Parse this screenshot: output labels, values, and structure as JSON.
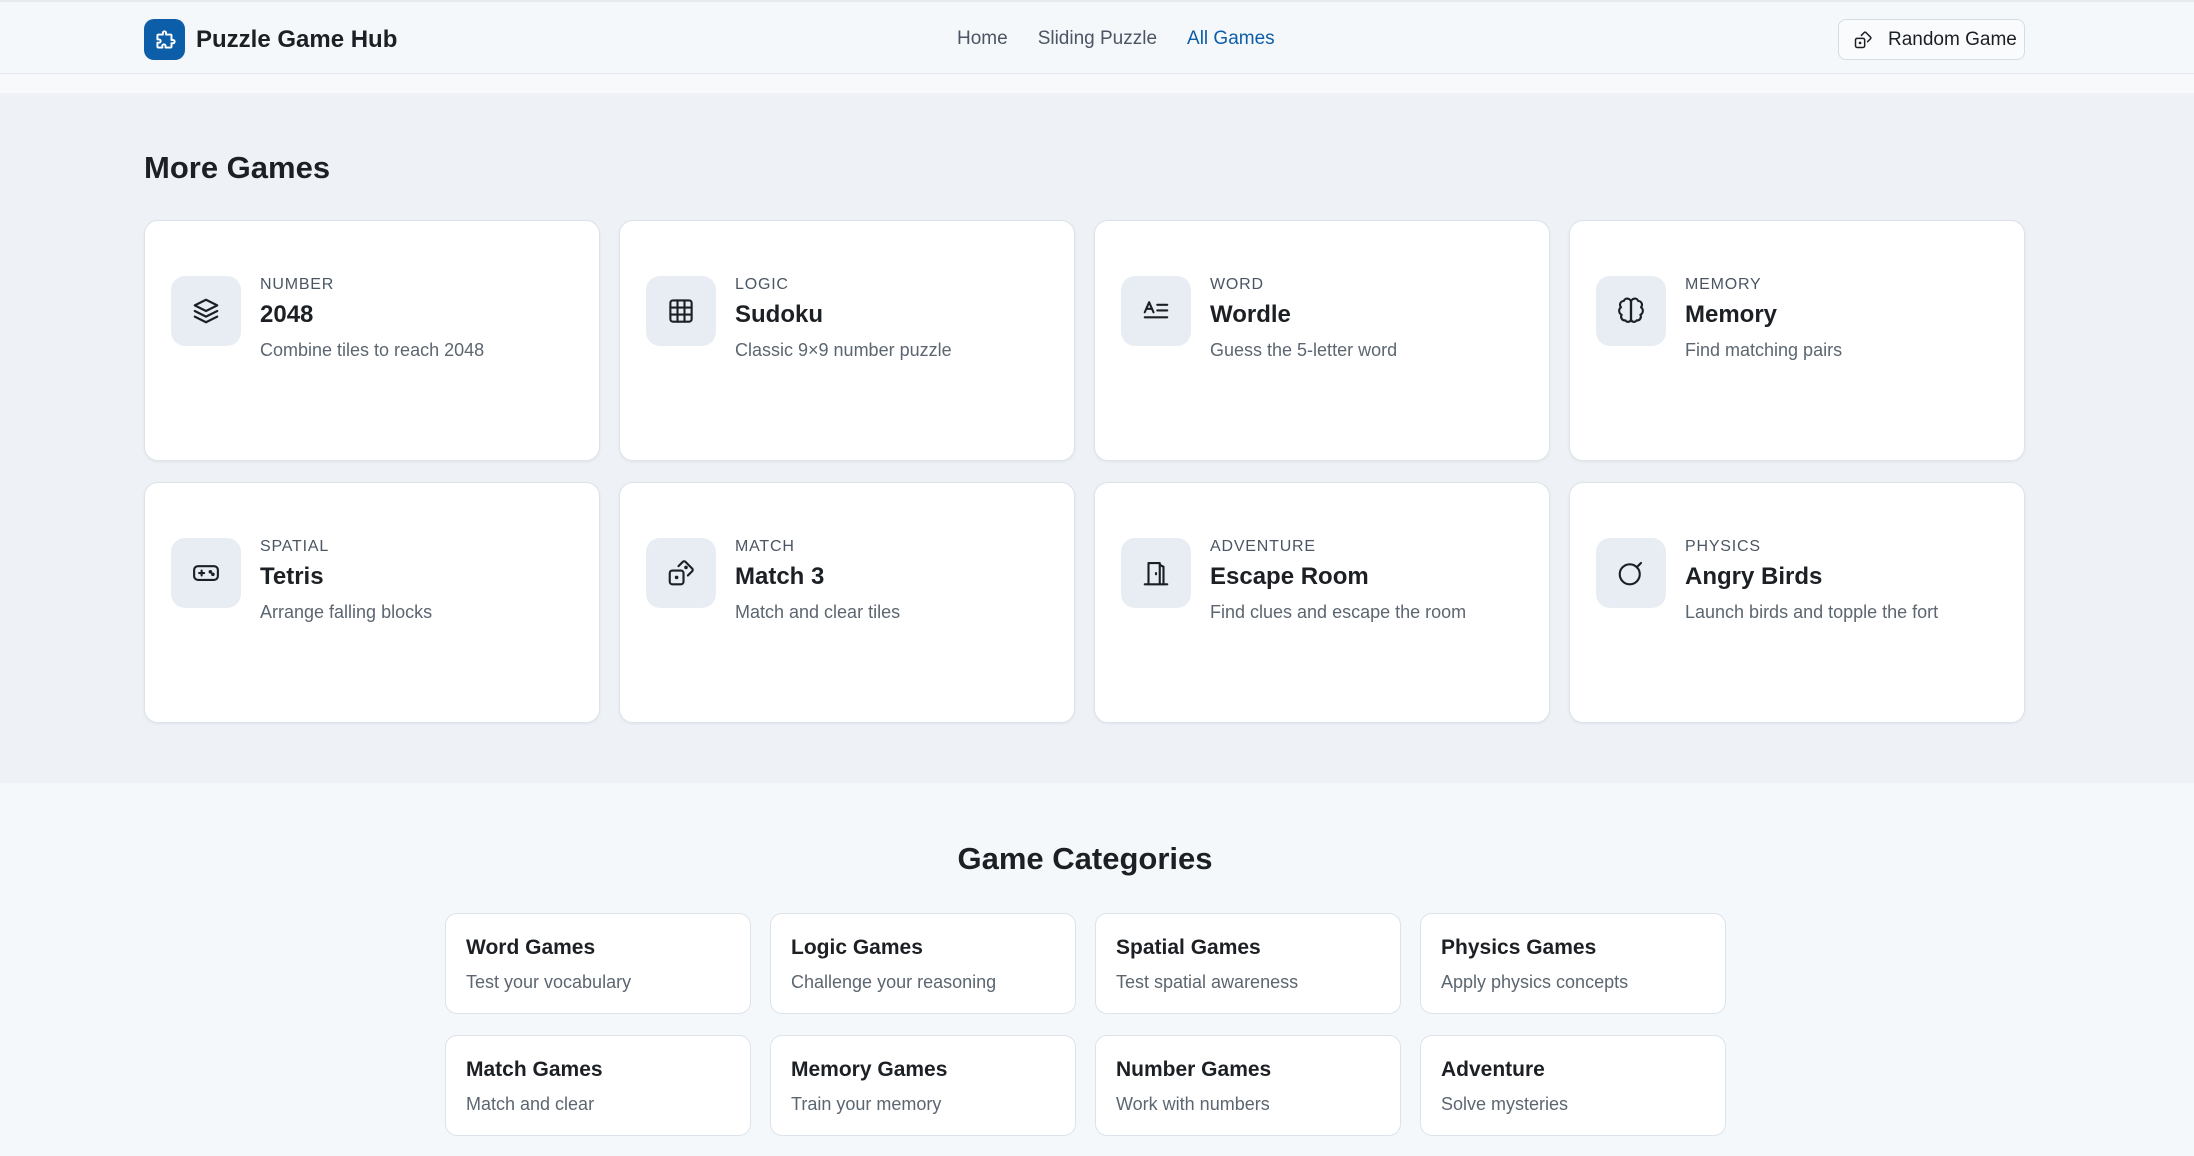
{
  "header": {
    "brand": "Puzzle Game Hub",
    "nav": [
      {
        "label": "Home",
        "active": false
      },
      {
        "label": "Sliding Puzzle",
        "active": false
      },
      {
        "label": "All Games",
        "active": true
      }
    ],
    "random_button": "Random Game",
    "accent_color": "#0d5ea8"
  },
  "games_section": {
    "title": "More Games",
    "games": [
      {
        "category": "NUMBER",
        "title": "2048",
        "description": "Combine tiles to reach 2048",
        "icon": "layers-icon"
      },
      {
        "category": "LOGIC",
        "title": "Sudoku",
        "description": "Classic 9×9 number puzzle",
        "icon": "grid-icon"
      },
      {
        "category": "WORD",
        "title": "Wordle",
        "description": "Guess the 5-letter word",
        "icon": "text-icon"
      },
      {
        "category": "MEMORY",
        "title": "Memory",
        "description": "Find matching pairs",
        "icon": "brain-icon"
      },
      {
        "category": "SPATIAL",
        "title": "Tetris",
        "description": "Arrange falling blocks",
        "icon": "gamepad-icon"
      },
      {
        "category": "MATCH",
        "title": "Match 3",
        "description": "Match and clear tiles",
        "icon": "dice-icon"
      },
      {
        "category": "ADVENTURE",
        "title": "Escape Room",
        "description": "Find clues and escape the room",
        "icon": "door-icon"
      },
      {
        "category": "PHYSICS",
        "title": "Angry Birds",
        "description": "Launch birds and topple the fort",
        "icon": "bomb-icon"
      }
    ]
  },
  "categories_section": {
    "title": "Game Categories",
    "categories": [
      {
        "name": "Word Games",
        "description": "Test your vocabulary"
      },
      {
        "name": "Logic Games",
        "description": "Challenge your reasoning"
      },
      {
        "name": "Spatial Games",
        "description": "Test spatial awareness"
      },
      {
        "name": "Physics Games",
        "description": "Apply physics concepts"
      },
      {
        "name": "Match Games",
        "description": "Match and clear"
      },
      {
        "name": "Memory Games",
        "description": "Train your memory"
      },
      {
        "name": "Number Games",
        "description": "Work with numbers"
      },
      {
        "name": "Adventure",
        "description": "Solve mysteries"
      }
    ]
  }
}
